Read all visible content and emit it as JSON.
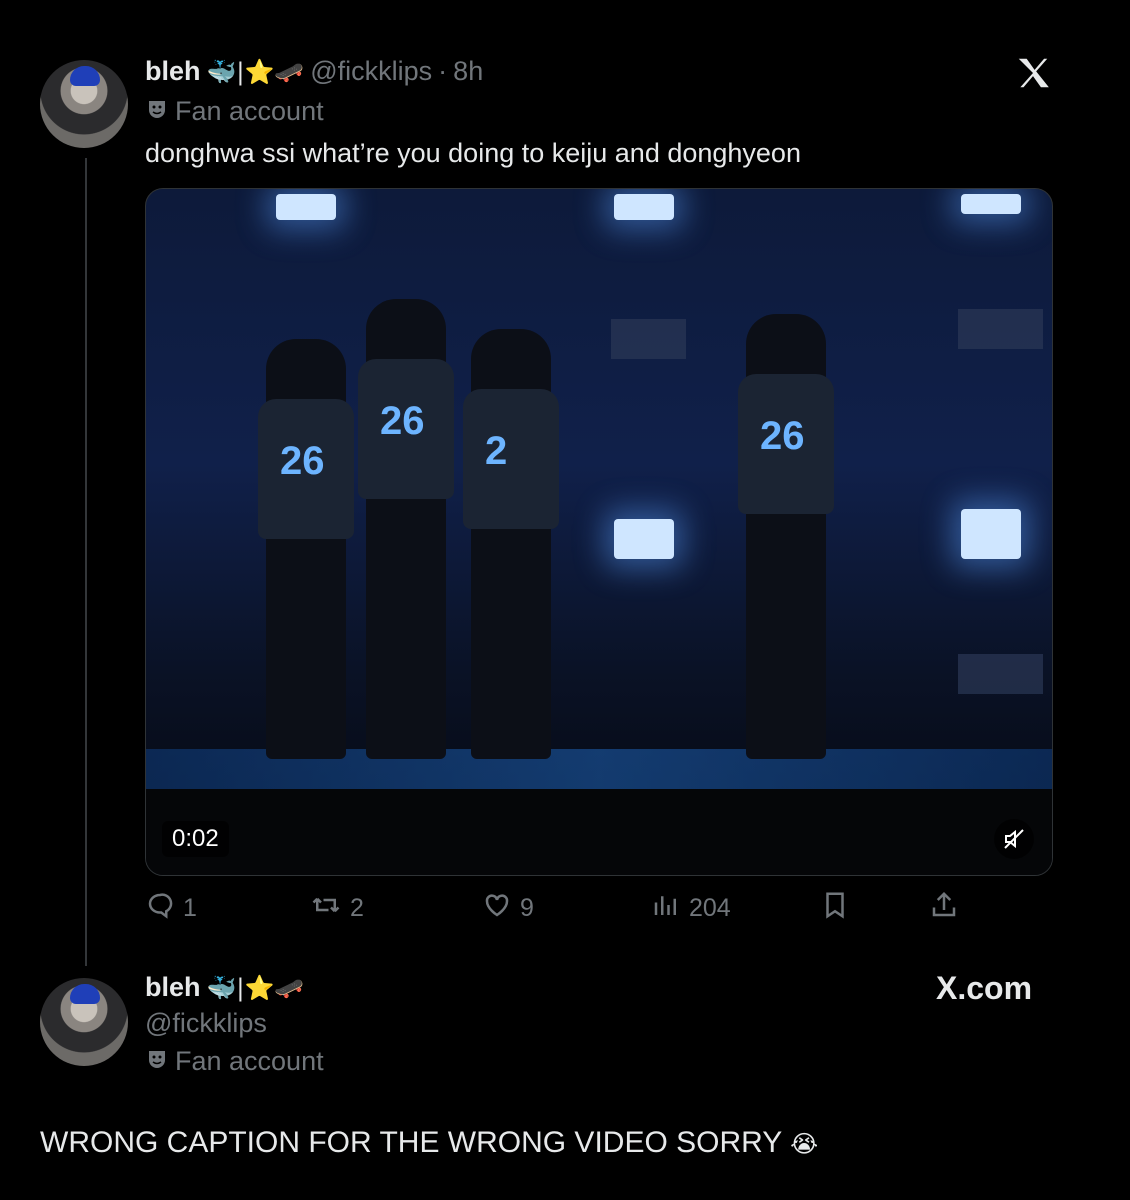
{
  "tweet": {
    "display_name": "bleh",
    "badges": "🐳|⭐🛹",
    "handle": "@fickklips",
    "separator": "·",
    "time": "8h",
    "label": "Fan account",
    "text": "donghwa ssi what’re you doing to keiju and donghyeon",
    "video_time": "0:02",
    "video_numbers": [
      "26",
      "26",
      "2",
      "26"
    ],
    "stats": {
      "replies": "1",
      "reposts": "2",
      "likes": "9",
      "views": "204"
    }
  },
  "quote_card": {
    "display_name": "bleh",
    "badges": "🐳|⭐🛹",
    "handle": "@fickklips",
    "label": "Fan account",
    "brand": "X.com"
  },
  "caption": {
    "text": "WRONG CAPTION FOR THE WRONG VIDEO SORRY",
    "emoji": "😭"
  },
  "icons": {
    "close": "x-logo-icon",
    "reply": "reply-icon",
    "repost": "repost-icon",
    "like": "heart-icon",
    "views": "views-icon",
    "bookmark": "bookmark-icon",
    "share": "share-icon",
    "mute": "mute-icon",
    "fan": "mask-icon"
  },
  "colors": {
    "background": "#000000",
    "text": "#e7e9ea",
    "muted": "#71767b"
  }
}
